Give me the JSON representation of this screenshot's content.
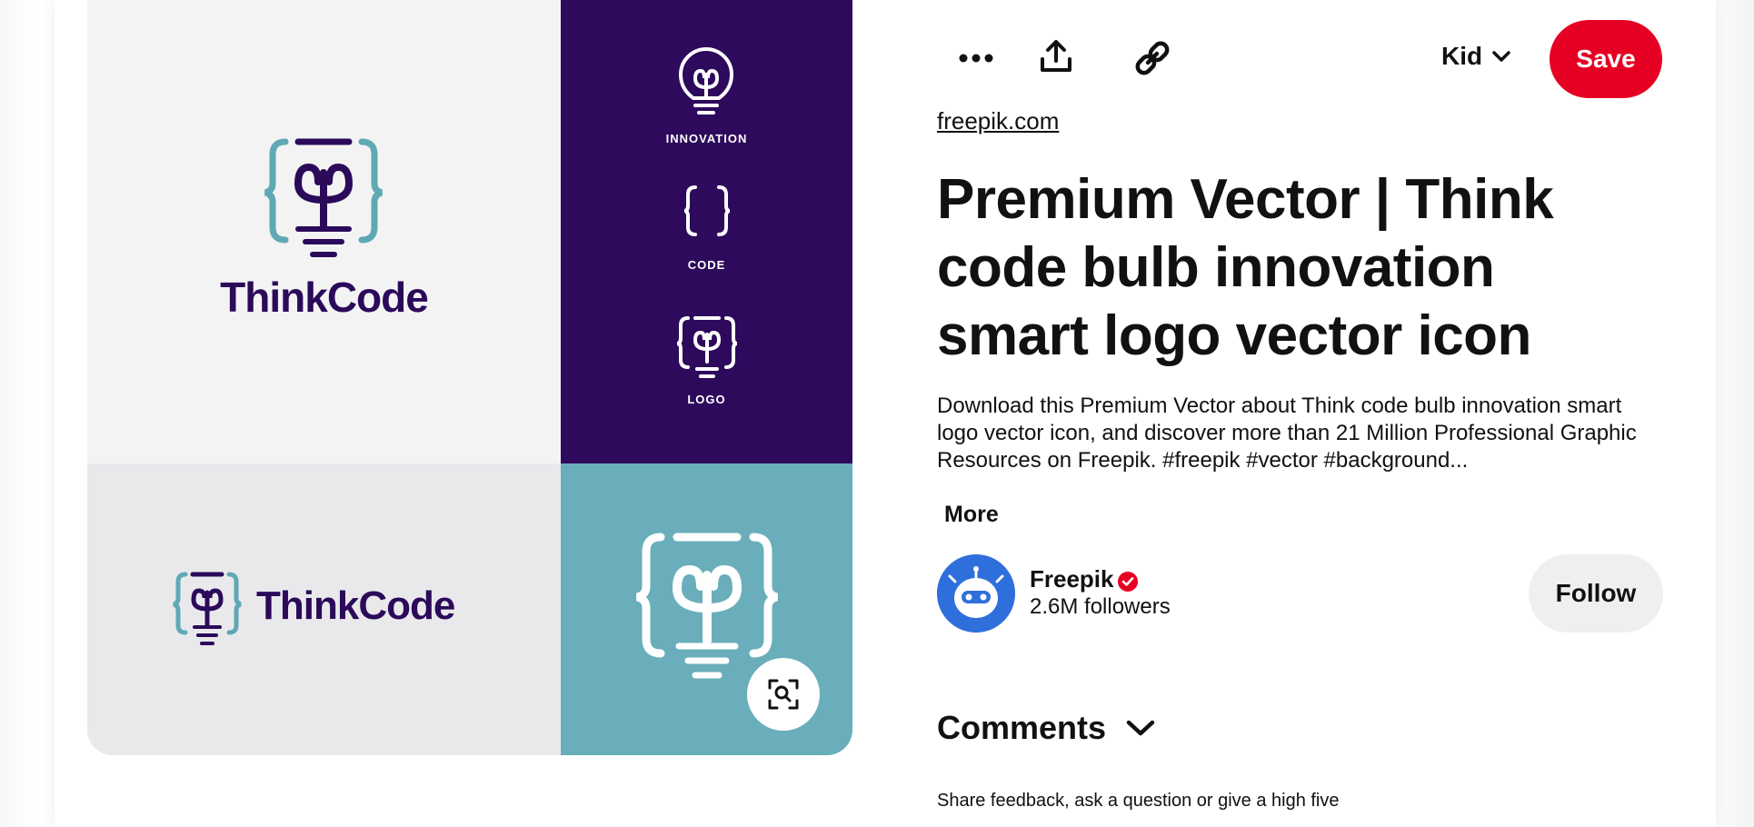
{
  "toolbar": {
    "more_icon": "ellipsis-icon",
    "share_icon": "share-upload-icon",
    "link_icon": "link-icon",
    "profile_label": "Kid",
    "save_label": "Save"
  },
  "pin": {
    "source": "freepik.com",
    "title": "Premium Vector | Think code bulb innovation smart logo vector icon",
    "description": "Download this Premium Vector about Think code bulb innovation smart logo vector icon, and discover more than 21 Million Professional Graphic Resources on Freepik. #freepik #vector #background...",
    "more_label": "More"
  },
  "image": {
    "brand_main": "ThinkCode",
    "brand_horizontal": "ThinkCode",
    "label_innovation": "INNOVATION",
    "label_code": "CODE",
    "label_logo": "LOGO",
    "colors": {
      "purple": "#2d0a5c",
      "teal": "#6aaebb",
      "brand_text": "#2b0a5a"
    }
  },
  "creator": {
    "name": "Freepik",
    "followers": "2.6M followers",
    "follow_label": "Follow"
  },
  "comments": {
    "header": "Comments",
    "hint": "Share feedback, ask a question or give a high five"
  },
  "colors": {
    "save": "#e60023",
    "follow_bg": "#efefef"
  }
}
